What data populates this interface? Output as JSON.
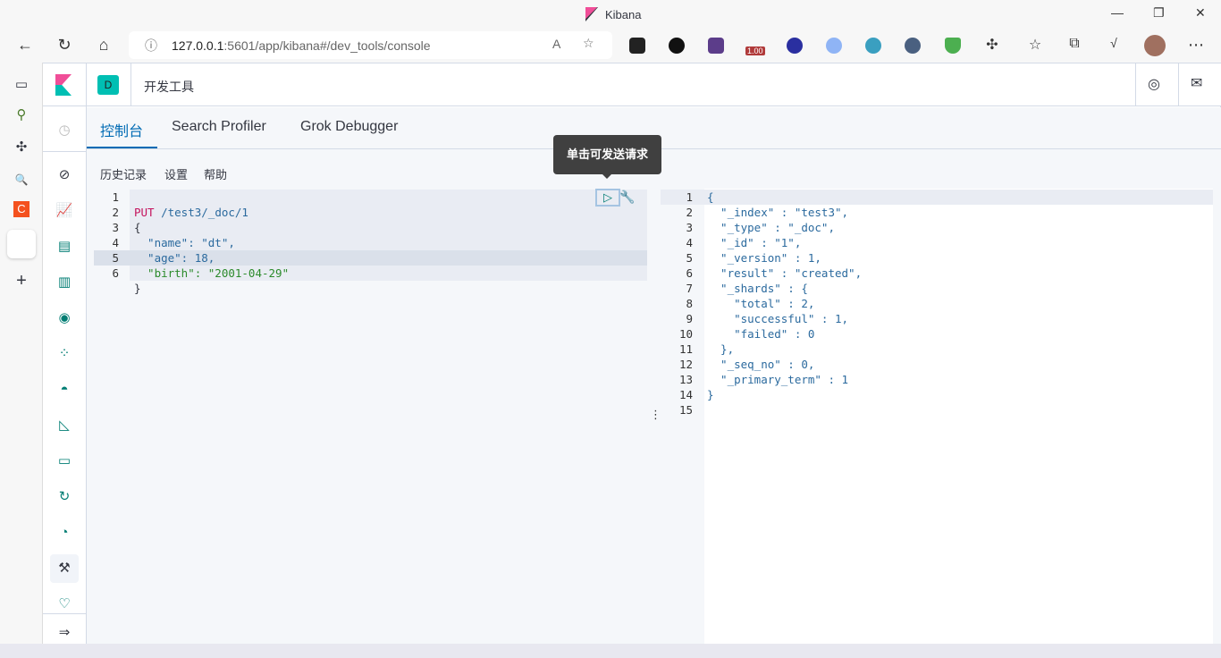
{
  "window": {
    "title": "Kibana"
  },
  "browser": {
    "url_host": "127.0.0.1",
    "url_rest": ":5601/app/kibana#/dev_tools/console",
    "ext_badge": "1.00"
  },
  "header": {
    "space_initial": "D",
    "breadcrumb": "开发工具"
  },
  "tabs": [
    {
      "label": "控制台",
      "active": true
    },
    {
      "label": "Search Profiler"
    },
    {
      "label": "Grok Debugger"
    }
  ],
  "toolbar": {
    "history": "历史记录",
    "settings": "设置",
    "help": "帮助"
  },
  "tooltip": "单击可发送请求",
  "request": {
    "method": "PUT",
    "path": "/test3/_doc/1",
    "lines": [
      "{",
      "  \"name\": \"dt\",",
      "  \"age\": 18,",
      "  \"birth\": \"2001-04-29\"",
      "}"
    ]
  },
  "response": {
    "lines": [
      "{",
      "  \"_index\" : \"test3\",",
      "  \"_type\" : \"_doc\",",
      "  \"_id\" : \"1\",",
      "  \"_version\" : 1,",
      "  \"result\" : \"created\",",
      "  \"_shards\" : {",
      "    \"total\" : 2,",
      "    \"successful\" : 1,",
      "    \"failed\" : 0",
      "  },",
      "  \"_seq_no\" : 0,",
      "  \"_primary_term\" : 1",
      "}",
      ""
    ]
  },
  "colors": {
    "accent": "#006bb4",
    "teal": "#00bfb3",
    "pink": "#f04e98"
  }
}
